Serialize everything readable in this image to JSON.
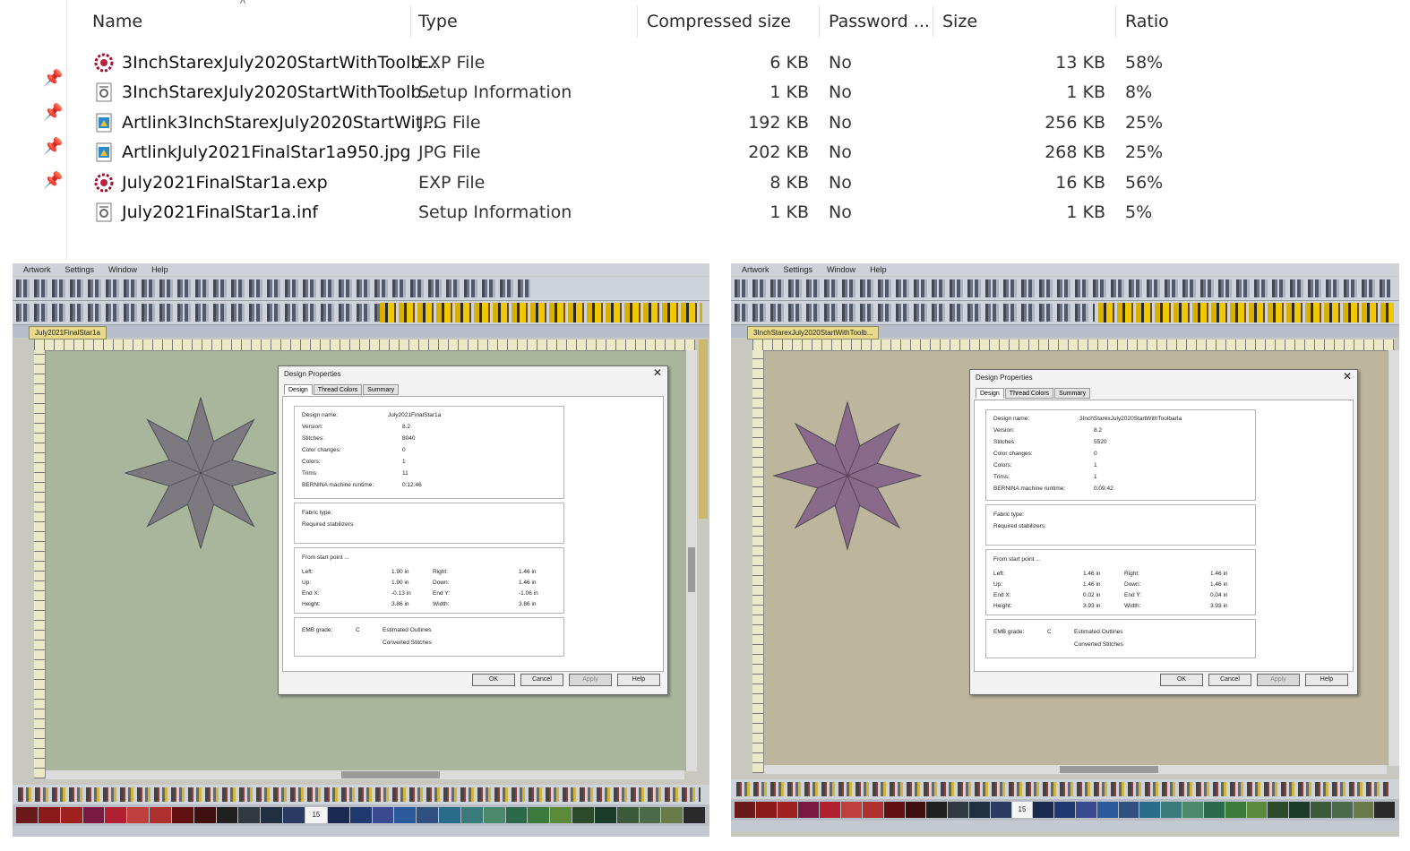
{
  "explorer": {
    "sort_indicator": "^",
    "columns": {
      "name": "Name",
      "type": "Type",
      "compressed_size": "Compressed size",
      "password": "Password ...",
      "size": "Size",
      "ratio": "Ratio"
    },
    "rows": [
      {
        "icon": "exp-file-icon",
        "name": "3InchStarexJuly2020StartWithToolb...",
        "type": "EXP File",
        "compressed": "6 KB",
        "password": "No",
        "size": "13 KB",
        "ratio": "58%"
      },
      {
        "icon": "setup-info-icon",
        "name": "3InchStarexJuly2020StartWithToolb...",
        "type": "Setup Information",
        "compressed": "1 KB",
        "password": "No",
        "size": "1 KB",
        "ratio": "8%"
      },
      {
        "icon": "jpg-file-icon",
        "name": "Artlink3InchStarexJuly2020StartWit...",
        "type": "JPG File",
        "compressed": "192 KB",
        "password": "No",
        "size": "256 KB",
        "ratio": "25%"
      },
      {
        "icon": "jpg-file-icon",
        "name": "ArtlinkJuly2021FinalStar1a950.jpg",
        "type": "JPG File",
        "compressed": "202 KB",
        "password": "No",
        "size": "268 KB",
        "ratio": "25%"
      },
      {
        "icon": "exp-file-icon",
        "name": "July2021FinalStar1a.exp",
        "type": "EXP File",
        "compressed": "8 KB",
        "password": "No",
        "size": "16 KB",
        "ratio": "56%"
      },
      {
        "icon": "setup-info-icon",
        "name": "July2021FinalStar1a.inf",
        "type": "Setup Information",
        "compressed": "1 KB",
        "password": "No",
        "size": "1 KB",
        "ratio": "5%"
      }
    ]
  },
  "left_window": {
    "menu": [
      "Artwork",
      "Settings",
      "Window",
      "Help"
    ],
    "doc_tab": "July2021FinalStar1a",
    "canvas_color": "#a9b69c",
    "star_color": "#7c7a80",
    "dialog": {
      "title": "Design Properties",
      "tabs": [
        "Design",
        "Thread Colors",
        "Summary"
      ],
      "design_name_label": "Design name:",
      "design_name": "July2021FinalStar1a",
      "version_label": "Version:",
      "version": "8.2",
      "stitches_label": "Stitches:",
      "stitches": "8040",
      "color_changes_label": "Color changes:",
      "color_changes": "0",
      "colors_label": "Colors:",
      "colors": "1",
      "trims_label": "Trims:",
      "trims": "11",
      "runtime_label": "BERNINA machine runtime:",
      "runtime": "0:12:46",
      "fabric_label": "Fabric type:",
      "stabilizer_label": "Required stabilizers:",
      "start_label": "From start point ...",
      "left_label": "Left:",
      "left": "1.90 in",
      "right_label": "Right:",
      "right": "1.46 in",
      "up_label": "Up:",
      "up": "1.90 in",
      "down_label": "Down:",
      "down": "1.46 in",
      "endx_label": "End X:",
      "endx": "-0.13 in",
      "endy_label": "End Y:",
      "endy": "-1.06 in",
      "height_label": "Height:",
      "height": "3.86 in",
      "width_label": "Width:",
      "width": "3.86 in",
      "emb_label": "EMB grade:",
      "emb": "C",
      "est_outlines": "Estimated Outlines",
      "conv_stitches": "Converted Stitches",
      "ok": "OK",
      "cancel": "Cancel",
      "apply": "Apply",
      "help": "Help"
    },
    "palette_start": "15"
  },
  "right_window": {
    "menu": [
      "Artwork",
      "Settings",
      "Window",
      "Help"
    ],
    "doc_tab": "3InchStarexJuly2020StartWithToolb...",
    "canvas_color": "#bdb59c",
    "star_color": "#8a6a8a",
    "dialog": {
      "title": "Design Properties",
      "tabs": [
        "Design",
        "Thread Colors",
        "Summary"
      ],
      "design_name_label": "Design name:",
      "design_name": "3InchStarexJuly2020StartWithToolbarIa",
      "version_label": "Version:",
      "version": "8.2",
      "stitches_label": "Stitches:",
      "stitches": "5520",
      "color_changes_label": "Color changes:",
      "color_changes": "0",
      "colors_label": "Colors:",
      "colors": "1",
      "trims_label": "Trims:",
      "trims": "1",
      "runtime_label": "BERNINA machine runtime:",
      "runtime": "0:09:42",
      "fabric_label": "Fabric type:",
      "stabilizer_label": "Required stabilizers:",
      "start_label": "From start point ...",
      "left_label": "Left:",
      "left": "1.46 in",
      "right_label": "Right:",
      "right": "1.46 in",
      "up_label": "Up:",
      "up": "1.46 in",
      "down_label": "Down:",
      "down": "1.46 in",
      "endx_label": "End X:",
      "endx": "0.02 in",
      "endy_label": "End Y:",
      "endy": "0.04 in",
      "height_label": "Height:",
      "height": "3.93 in",
      "width_label": "Width:",
      "width": "3.93 in",
      "emb_label": "EMB grade:",
      "emb": "C",
      "est_outlines": "Estimated Outlines",
      "conv_stitches": "Converted Stitches",
      "ok": "OK",
      "cancel": "Cancel",
      "apply": "Apply",
      "help": "Help"
    },
    "palette_start": "15"
  }
}
